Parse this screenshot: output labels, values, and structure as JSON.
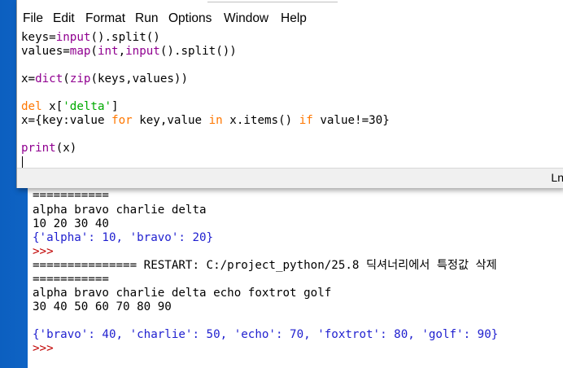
{
  "menu": {
    "file": "File",
    "edit": "Edit",
    "format": "Format",
    "run": "Run",
    "options": "Options",
    "window": "Window",
    "help": "Help"
  },
  "editor": {
    "lines": {
      "l1_a": "keys=",
      "l1_b": "input",
      "l1_c": "().split()",
      "l2_a": "values=",
      "l2_b": "map",
      "l2_c": "(",
      "l2_d": "int",
      "l2_e": ",",
      "l2_f": "input",
      "l2_g": "().split())",
      "l4_a": "x=",
      "l4_b": "dict",
      "l4_c": "(",
      "l4_d": "zip",
      "l4_e": "(keys,values))",
      "l6_a": "del",
      "l6_b": " x[",
      "l6_c": "'delta'",
      "l6_d": "]",
      "l7_a": "x={key:value ",
      "l7_b": "for",
      "l7_c": " key,value ",
      "l7_d": "in",
      "l7_e": " x.items() ",
      "l7_f": "if",
      "l7_g": " value!=30}",
      "l9_a": "print",
      "l9_b": "(x)"
    },
    "status": "Ln"
  },
  "shell": {
    "line0": "===========",
    "line1": "alpha bravo charlie delta",
    "line2": "10 20 30 40",
    "line3": "{'alpha': 10, 'bravo': 20}",
    "line4": ">>>",
    "line5": "=============== RESTART: C:/project_python/25.8 딕셔너리에서 특정값 삭제",
    "line6": "===========",
    "line7": "alpha bravo charlie delta echo foxtrot golf",
    "line8": "30 40 50 60 70 80 90",
    "line9": "{'bravo': 40, 'charlie': 50, 'echo': 70, 'foxtrot': 80, 'golf': 90}",
    "line10": ">>>"
  }
}
